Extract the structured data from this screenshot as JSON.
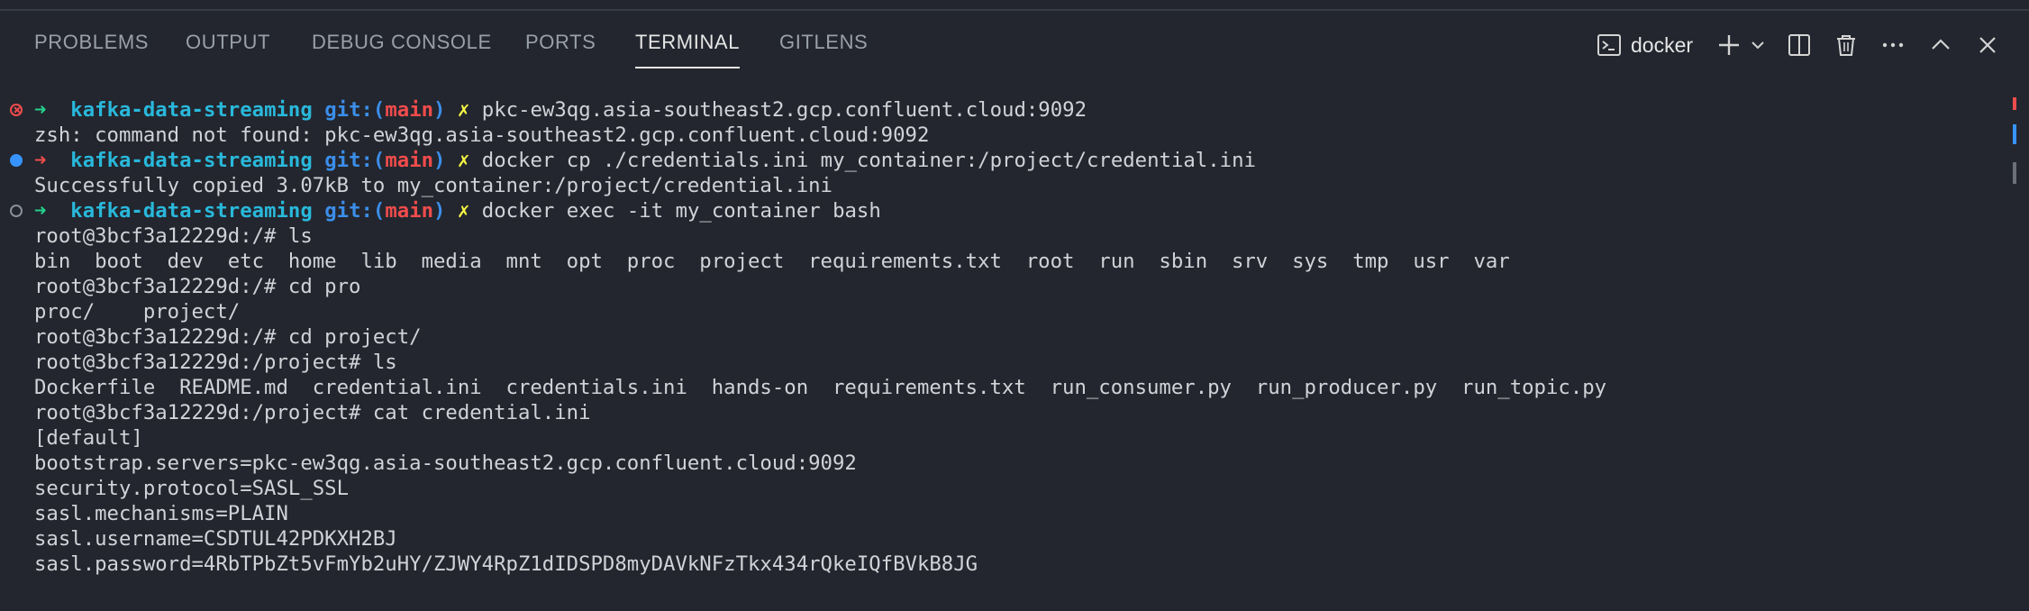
{
  "tabs": [
    {
      "label": "PROBLEMS"
    },
    {
      "label": "OUTPUT"
    },
    {
      "label": "DEBUG CONSOLE"
    },
    {
      "label": "PORTS"
    },
    {
      "label": "TERMINAL",
      "active": true
    },
    {
      "label": "GITLENS"
    }
  ],
  "toolbar": {
    "shell_name": "docker",
    "icons": [
      "terminal-icon",
      "plus-icon",
      "chevron-down-icon",
      "split-icon",
      "trash-icon",
      "more-icon",
      "chevron-up-icon",
      "close-icon"
    ]
  },
  "colors": {
    "background": "#23262e",
    "prompt_arrow_ok": "#23d18b",
    "prompt_arrow_err": "#f14c4c",
    "repo": "#29b8db",
    "git": "#3b8eea",
    "branch": "#f14c4c",
    "dirty_mark": "#f5f543",
    "success_dot": "#3794ff"
  },
  "prompt": {
    "arrow": "➜",
    "repo": "kafka-data-streaming",
    "git_prefix": "git:(",
    "branch": "main",
    "git_suffix": ")",
    "dirty": "✗"
  },
  "commands": [
    {
      "cmd": "pkc-ew3qg.asia-southeast2.gcp.confluent.cloud:9092",
      "status": "error"
    },
    {
      "cmd": "docker cp ./credentials.ini my_container:/project/credential.ini",
      "status": "success"
    },
    {
      "cmd": "docker exec -it my_container bash",
      "status": "running"
    }
  ],
  "output": {
    "l2": "zsh: command not found: pkc-ew3qg.asia-southeast2.gcp.confluent.cloud:9092",
    "l4": "Successfully copied 3.07kB to my_container:/project/credential.ini",
    "l6": "root@3bcf3a12229d:/# ls",
    "l7": "bin  boot  dev  etc  home  lib  media  mnt  opt  proc  project  requirements.txt  root  run  sbin  srv  sys  tmp  usr  var",
    "l8": "root@3bcf3a12229d:/# cd pro",
    "l9": "proc/    project/",
    "l10": "root@3bcf3a12229d:/# cd project/",
    "l11": "root@3bcf3a12229d:/project# ls",
    "l12": "Dockerfile  README.md  credential.ini  credentials.ini  hands-on  requirements.txt  run_consumer.py  run_producer.py  run_topic.py",
    "l13": "root@3bcf3a12229d:/project# cat credential.ini",
    "l14": "[default]",
    "l15": "bootstrap.servers=pkc-ew3qg.asia-southeast2.gcp.confluent.cloud:9092",
    "l16": "security.protocol=SASL_SSL",
    "l17": "sasl.mechanisms=PLAIN",
    "l18": "sasl.username=CSDTUL42PDKXH2BJ",
    "l19": "sasl.password=4RbTPbZt5vFmYb2uHY/ZJWY4RpZ1dIDSPD8myDAVkNFzTkx434rQkeIQfBVkB8JG"
  }
}
